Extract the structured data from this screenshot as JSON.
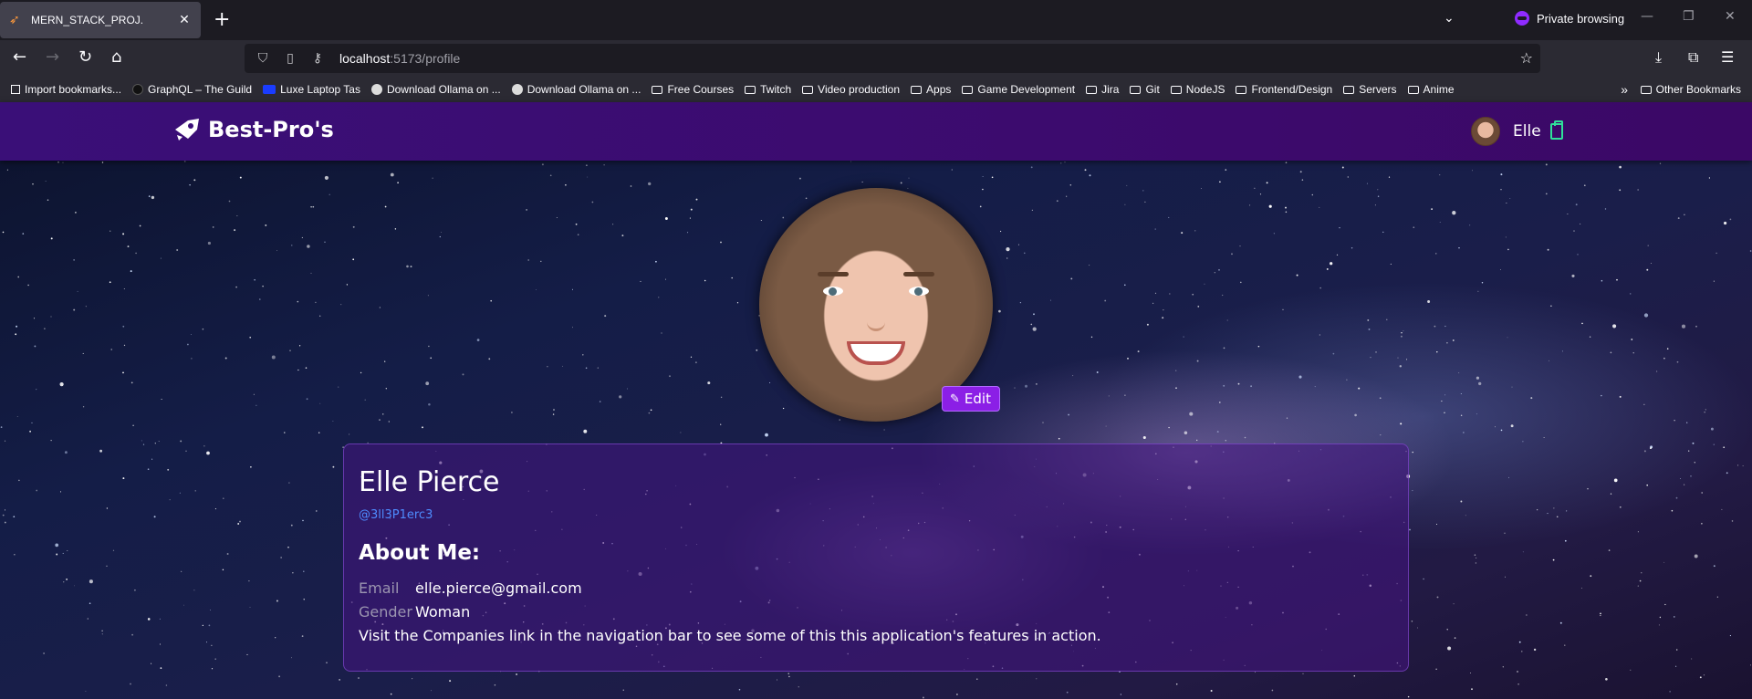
{
  "browser": {
    "tab_title": "MERN_STACK_PROJ.",
    "url_host": "localhost",
    "url_path": ":5173/profile",
    "private_label": "Private browsing",
    "bookmarks": [
      {
        "label": "Import bookmarks...",
        "icon": "import-icon"
      },
      {
        "label": "GraphQL – The Guild",
        "icon": "site-icon"
      },
      {
        "label": "Luxe Laptop Tas",
        "icon": "site-icon"
      },
      {
        "label": "Download Ollama on ...",
        "icon": "site-icon"
      },
      {
        "label": "Download Ollama on ...",
        "icon": "site-icon"
      },
      {
        "label": "Free Courses",
        "icon": "folder-icon"
      },
      {
        "label": "Twitch",
        "icon": "folder-icon"
      },
      {
        "label": "Video production",
        "icon": "folder-icon"
      },
      {
        "label": "Apps",
        "icon": "folder-icon"
      },
      {
        "label": "Game Development",
        "icon": "folder-icon"
      },
      {
        "label": "Jira",
        "icon": "folder-icon"
      },
      {
        "label": "Git",
        "icon": "folder-icon"
      },
      {
        "label": "NodeJS",
        "icon": "folder-icon"
      },
      {
        "label": "Frontend/Design",
        "icon": "folder-icon"
      },
      {
        "label": "Servers",
        "icon": "folder-icon"
      },
      {
        "label": "Anime",
        "icon": "folder-icon"
      }
    ],
    "other_bookmarks": "Other Bookmarks"
  },
  "app": {
    "brand": "Best-Pro's",
    "user_name": "Elle",
    "accent": "#8b1fe6",
    "header_color": "#3a0f78"
  },
  "profile": {
    "edit_label": "Edit",
    "full_name": "Elle Pierce",
    "handle": "@3ll3P1erc3",
    "about_heading": "About Me:",
    "email_label": "Email",
    "email_value": "elle.pierce@gmail.com",
    "gender_label": "Gender",
    "gender_value": "Woman",
    "note": "Visit the Companies link in the navigation bar to see some of this this application's features in action."
  }
}
